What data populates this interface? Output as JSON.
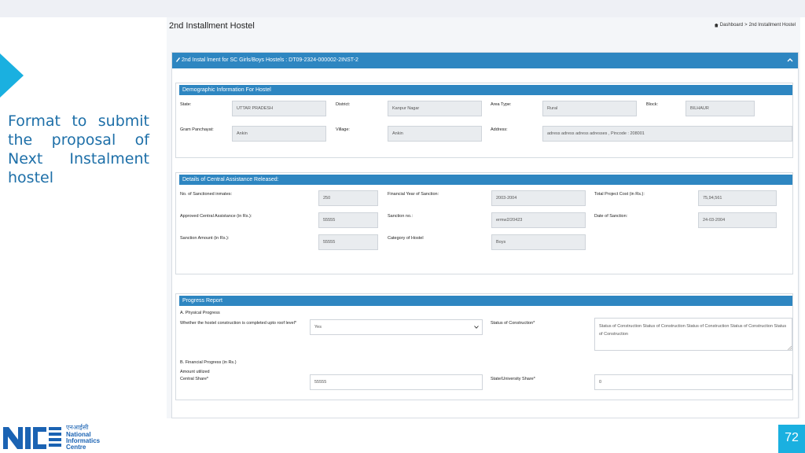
{
  "slide": {
    "caption": "Format to submit the proposal of Next Instalment hostel",
    "page_number": "72",
    "logo": {
      "hindi": "एनआईसी",
      "line1": "National",
      "line2": "Informatics",
      "line3": "Centre",
      "brand_color": "#1b63b3"
    }
  },
  "app": {
    "title": "2nd Installment Hostel",
    "breadcrumb": {
      "home": "Dashboard",
      "current": "2nd Installment Hostel"
    },
    "card_title": "2nd Instal lment for SC Girls/Boys Hostels : DT09-2324-000002-2INST-2",
    "accent": "#2e86c1"
  },
  "demographic": {
    "title": "Demographic Information For Hostel",
    "state_label": "State:",
    "state_value": "UTTAR PRADESH",
    "district_label": "District:",
    "district_value": "Kanpur Nagar",
    "area_label": "Area Type:",
    "area_value": "Rural",
    "block_label": "Block:",
    "block_value": "BILHAUR",
    "gp_label": "Gram Panchayat:",
    "gp_value": "Ankin",
    "village_label": "Village:",
    "village_value": "Ankin",
    "address_label": "Address:",
    "address_value": "adress adress adress adresses , Pincode : 208001"
  },
  "assistance": {
    "title": "Details of Central Assistance Released:",
    "inmates_label": "No. of Sanctioned inmates:",
    "inmates_value": "250",
    "fy_label": "Financial Year of Sanction:",
    "fy_value": "2003-2004",
    "cost_label": "Total Project Cost (in Rs.):",
    "cost_value": "75,94,561",
    "approved_label": "Approved Central Assistance (in Rs.):",
    "approved_value": "55555",
    "sanction_no_label": "Sanction no.:",
    "sanction_no_value": "ermw2/20423",
    "date_label": "Date of Sanction:",
    "date_value": "24-03-2004",
    "amount_label": "Sanction Amount (in Rs.):",
    "amount_value": "55555",
    "category_label": "Category of Hostel",
    "category_value": "Boys"
  },
  "progress": {
    "title": "Progress Report",
    "physical_head": "A. Physical Progress",
    "roof_label": "Whether the hostel construction is completed upto roof level*",
    "roof_value": "Yes",
    "status_label": "Status of Construction*",
    "status_value": "Status of Construction Status of Construction Status of Construction Status of Construction Status of Construction",
    "financial_head": "B. Financial Progress (in Rs.)",
    "amount_utilized": "Amount utilized",
    "central_label": "Central Share*",
    "central_value": "55555",
    "state_share_label": "State/University Share*",
    "state_share_value": "0"
  }
}
